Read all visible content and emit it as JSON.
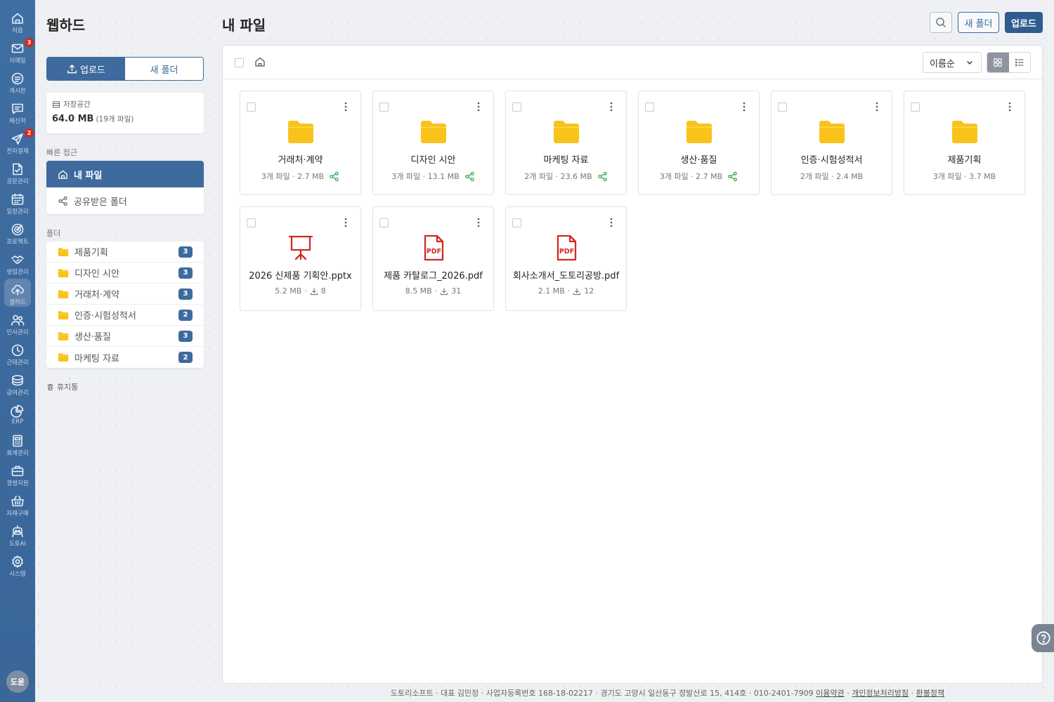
{
  "rail": {
    "items": [
      {
        "label": "처음",
        "icon": "home-icon"
      },
      {
        "label": "이메일",
        "icon": "mail-icon",
        "badge": "3"
      },
      {
        "label": "게시판",
        "icon": "board-icon"
      },
      {
        "label": "메신저",
        "icon": "messenger-icon"
      },
      {
        "label": "전자결재",
        "icon": "approval-icon",
        "badge": "2"
      },
      {
        "label": "공문관리",
        "icon": "document-icon"
      },
      {
        "label": "일정관리",
        "icon": "calendar-icon"
      },
      {
        "label": "프로젝트",
        "icon": "target-icon"
      },
      {
        "label": "영업관리",
        "icon": "handshake-icon"
      },
      {
        "label": "웹하드",
        "icon": "cloud-upload-icon",
        "active": true
      },
      {
        "label": "인사관리",
        "icon": "people-icon"
      },
      {
        "label": "근태관리",
        "icon": "clock-icon"
      },
      {
        "label": "급여관리",
        "icon": "coins-icon"
      },
      {
        "label": "ERP",
        "icon": "pie-chart-icon"
      },
      {
        "label": "회계관리",
        "icon": "calculator-icon"
      },
      {
        "label": "경영지원",
        "icon": "briefcase-icon"
      },
      {
        "label": "자재구매",
        "icon": "basket-icon"
      },
      {
        "label": "도토AI",
        "icon": "robot-icon"
      },
      {
        "label": "시스템",
        "icon": "gear-icon"
      }
    ],
    "avatar": "도윤"
  },
  "sidebar": {
    "title": "웹하드",
    "upload_label": "업로드",
    "new_folder_label": "새 폴더",
    "storage_label": "저장공간",
    "storage_value": "64.0 MB",
    "storage_files": "(19개 파일)",
    "quick_access_label": "빠른 접근",
    "quick_items": [
      "내 파일",
      "공유받은 폴더"
    ],
    "folders_label": "폴더",
    "folders": [
      {
        "name": "제품기획",
        "count": "3"
      },
      {
        "name": "디자인 시안",
        "count": "3"
      },
      {
        "name": "거래처·계약",
        "count": "3"
      },
      {
        "name": "인증·시험성적서",
        "count": "2"
      },
      {
        "name": "생산·품질",
        "count": "3"
      },
      {
        "name": "마케팅 자료",
        "count": "2"
      }
    ],
    "trash_label": "휴지통"
  },
  "header": {
    "title": "내 파일",
    "new_folder_label": "새 폴더",
    "upload_label": "업로드"
  },
  "toolbar": {
    "sort_value": "이름순"
  },
  "items": [
    {
      "type": "folder",
      "name": "거래처·계약",
      "meta": "3개 파일 · 2.7 MB",
      "shared": true
    },
    {
      "type": "folder",
      "name": "디자인 시안",
      "meta": "3개 파일 · 13.1 MB",
      "shared": true
    },
    {
      "type": "folder",
      "name": "마케팅 자료",
      "meta": "2개 파일 · 23.6 MB",
      "shared": true
    },
    {
      "type": "folder",
      "name": "생산·품질",
      "meta": "3개 파일 · 2.7 MB",
      "shared": true
    },
    {
      "type": "folder",
      "name": "인증·시험성적서",
      "meta": "2개 파일 · 2.4 MB",
      "shared": false
    },
    {
      "type": "folder",
      "name": "제품기획",
      "meta": "3개 파일 · 3.7 MB",
      "shared": false
    },
    {
      "type": "presentation",
      "name": "2026 신제품 기획안.pptx",
      "size": "5.2 MB",
      "downloads": "8"
    },
    {
      "type": "pdf",
      "name": "제품 카탈로그_2026.pdf",
      "size": "8.5 MB",
      "downloads": "31"
    },
    {
      "type": "pdf",
      "name": "회사소개서_도토리공방.pdf",
      "size": "2.1 MB",
      "downloads": "12"
    }
  ],
  "footer": {
    "company_info": "도토리소프트 · 대표 김민정 · 사업자등록번호 168-18-02217 · 경기도 고양시 일산동구 정발산로 15, 414호 · 010-2401-7909",
    "terms": "이용약관",
    "privacy": "개인정보처리방침",
    "refund": "환불정책"
  },
  "colors": {
    "rail": "#3f6ea2",
    "primary": "#3e6a9e",
    "folder": "#f9c31b",
    "pdf": "#d02a22",
    "share": "#3aa853"
  }
}
